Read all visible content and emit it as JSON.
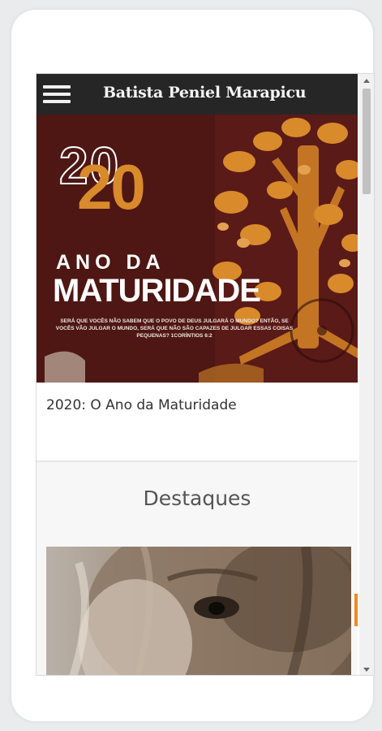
{
  "header": {
    "site_title": "Batista Peniel Marapicu",
    "menu_icon": "hamburger-menu-icon"
  },
  "banner": {
    "year_outline": "20",
    "year_bold": "20",
    "line1": "ANO DA",
    "line2": "MATURIDADE",
    "verse": "SERÁ QUE VOCÊS NÃO SABEM QUE O POVO DE DEUS JULGARÁ O MUNDO? ENTÃO, SE VOCÊS VÃO JULGAR O MUNDO, SERÁ QUE NÃO SÃO CAPAZES DE JULGAR ESSAS COISAS PEQUENAS? 1CORÍNTIOS 6:2",
    "colors": {
      "background": "#5a1a17",
      "accent": "#d98a2b",
      "text": "#ffffff"
    }
  },
  "post": {
    "title": "2020: O Ano da Maturidade"
  },
  "highlights": {
    "heading": "Destaques"
  },
  "colors": {
    "topbar": "#262626",
    "accent_orange": "#f08a24"
  }
}
